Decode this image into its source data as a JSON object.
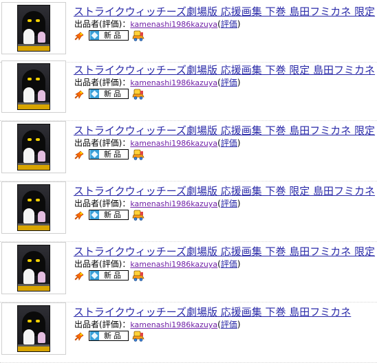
{
  "listings": [
    {
      "title": "ストライクウィッチーズ劇場版 応援画集 下巻 島田フミカネ 限定",
      "seller_prefix": "出品者(評価)：",
      "seller_name": "kamenashi1986kazuya",
      "paren_open": "(",
      "rating_label": "評価",
      "paren_close": ")",
      "badge_new": "新品"
    },
    {
      "title": "ストライクウィッチーズ劇場版 応援画集 下巻 限定 島田フミカネ",
      "seller_prefix": "出品者(評価)：",
      "seller_name": "kamenashi1986kazuya",
      "paren_open": "(",
      "rating_label": "評価",
      "paren_close": ")",
      "badge_new": "新品"
    },
    {
      "title": "ストライクウィッチーズ劇場版 応援画集 下巻 島田フミカネ 限定",
      "seller_prefix": "出品者(評価)：",
      "seller_name": "kamenashi1986kazuya",
      "paren_open": "(",
      "rating_label": "評価",
      "paren_close": ")",
      "badge_new": "新品"
    },
    {
      "title": "ストライクウィッチーズ劇場版 応援画集 下巻 限定 島田フミカネ",
      "seller_prefix": "出品者(評価)：",
      "seller_name": "kamenashi1986kazuya",
      "paren_open": "(",
      "rating_label": "評価",
      "paren_close": ")",
      "badge_new": "新品"
    },
    {
      "title": "ストライクウィッチーズ劇場版 応援画集 下巻 島田フミカネ 限定",
      "seller_prefix": "出品者(評価)：",
      "seller_name": "kamenashi1986kazuya",
      "paren_open": "(",
      "rating_label": "評価",
      "paren_close": ")",
      "badge_new": "新品"
    },
    {
      "title": "ストライクウィッチーズ劇場版 応援画集 下巻 島田フミカネ",
      "seller_prefix": "出品者(評価)：",
      "seller_name": "kamenashi1986kazuya",
      "paren_open": "(",
      "rating_label": "評価",
      "paren_close": ")",
      "badge_new": "新品"
    }
  ],
  "icons": {
    "pin": "pushpin-icon",
    "new_badge": "new-item-badge",
    "ship": "shipping-icon"
  },
  "colors": {
    "title_link": "#2a2aa8",
    "seller_link": "#6f1fa6",
    "badge_square": "#3aa0d8"
  }
}
